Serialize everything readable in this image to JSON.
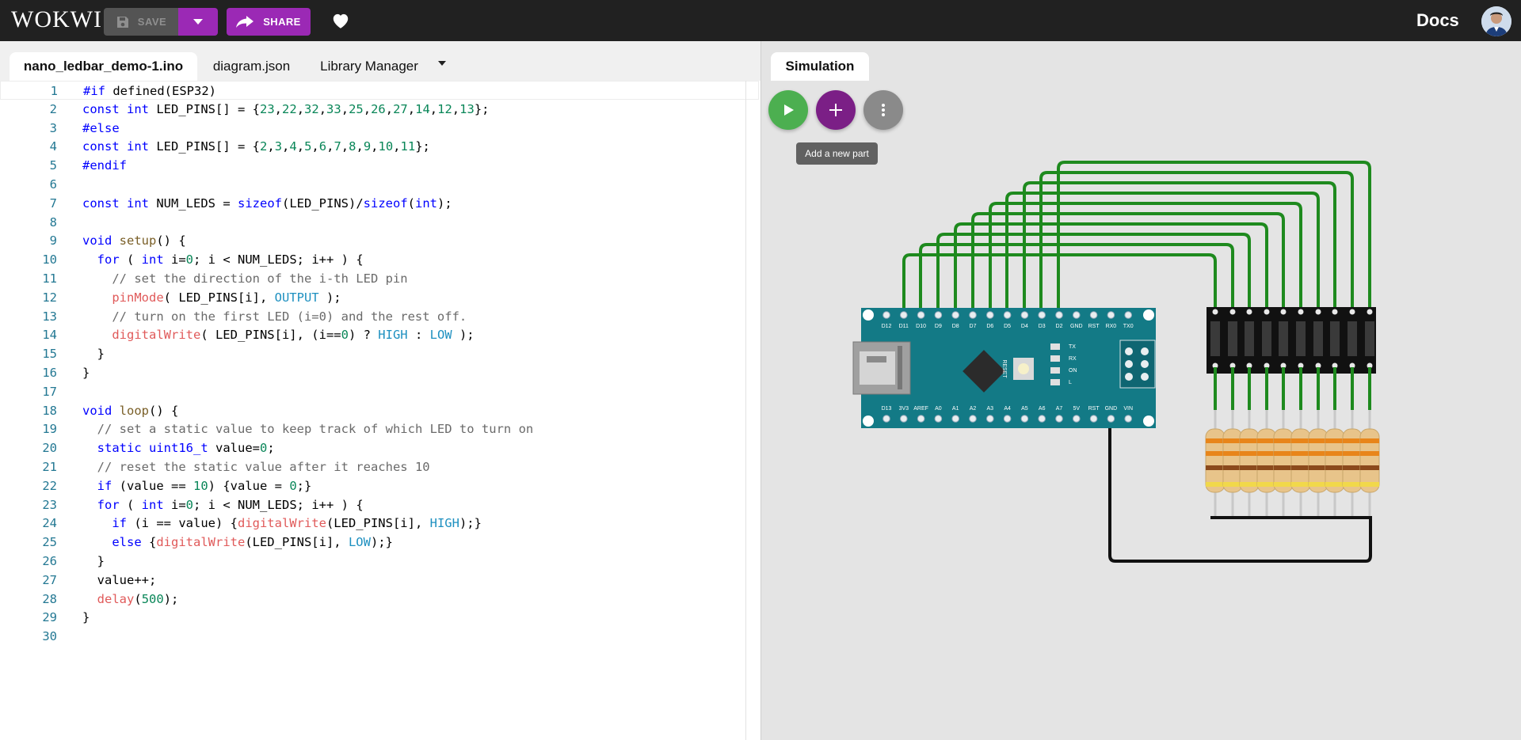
{
  "app": {
    "logo": "WOKWI"
  },
  "toolbar": {
    "save_label": "SAVE",
    "share_label": "SHARE",
    "docs_label": "Docs"
  },
  "editor": {
    "tabs": [
      "nano_ledbar_demo-1.ino",
      "diagram.json",
      "Library Manager"
    ],
    "lines": [
      "#if defined(ESP32)",
      "const int LED_PINS[] = {23,22,32,33,25,26,27,14,12,13};",
      "#else",
      "const int LED_PINS[] = {2,3,4,5,6,7,8,9,10,11};",
      "#endif",
      "",
      "const int NUM_LEDS = sizeof(LED_PINS)/sizeof(int);",
      "",
      "void setup() {",
      "  for ( int i=0; i < NUM_LEDS; i++ ) {",
      "    // set the direction of the i-th LED pin",
      "    pinMode( LED_PINS[i], OUTPUT );",
      "    // turn on the first LED (i=0) and the rest off.",
      "    digitalWrite( LED_PINS[i], (i==0) ? HIGH : LOW );",
      "  }",
      "}",
      "",
      "void loop() {",
      "  // set a static value to keep track of which LED to turn on",
      "  static uint16_t value=0;",
      "  // reset the static value after it reaches 10",
      "  if (value == 10) {value = 0;}",
      "  for ( int i=0; i < NUM_LEDS; i++ ) {",
      "    if (i == value) {digitalWrite(LED_PINS[i], HIGH);}",
      "    else {digitalWrite(LED_PINS[i], LOW);}",
      "  }",
      "  value++;",
      "  delay(500);",
      "}",
      ""
    ]
  },
  "simulation": {
    "tab_label": "Simulation",
    "tooltip": "Add a new part",
    "board": {
      "top_pins": [
        "D12",
        "D11",
        "D10",
        "D9",
        "D8",
        "D7",
        "D6",
        "D5",
        "D4",
        "D3",
        "D2",
        "GND",
        "RST",
        "RX0",
        "TX0"
      ],
      "bottom_pins": [
        "D13",
        "3V3",
        "AREF",
        "A0",
        "A1",
        "A2",
        "A3",
        "A4",
        "A5",
        "A6",
        "A7",
        "5V",
        "RST",
        "GND",
        "VIN"
      ],
      "reset_label": "RESET",
      "led_labels": [
        "TX",
        "RX",
        "ON",
        "L"
      ]
    },
    "colors": {
      "wire": "#1e8a1e",
      "gnd_wire": "#111111",
      "board": "#137a86",
      "accent": "#9b29b5",
      "run": "#4caf50"
    }
  }
}
